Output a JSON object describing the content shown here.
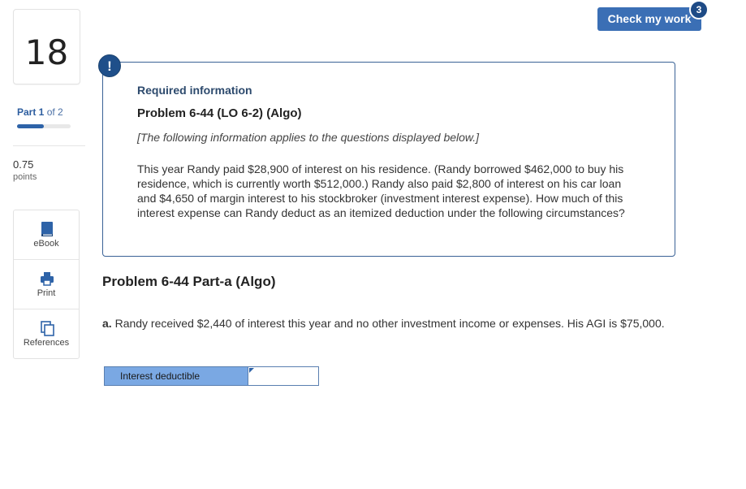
{
  "question": {
    "number": "18"
  },
  "part": {
    "current": "Part 1",
    "of": "of 2",
    "progress": 0.5
  },
  "points": {
    "value": "0.75",
    "label": "points"
  },
  "tools": [
    {
      "label": "eBook",
      "icon": "book-icon"
    },
    {
      "label": "Print",
      "icon": "printer-icon"
    },
    {
      "label": "References",
      "icon": "references-icon"
    }
  ],
  "check_work": {
    "label": "Check my work",
    "badge": "3"
  },
  "required_info": {
    "alert": "!",
    "heading": "Required information",
    "title": "Problem 6-44 (LO 6-2) (Algo)",
    "note": "[The following information applies to the questions displayed below.]",
    "body": "This year Randy paid $28,900 of interest on his residence. (Randy borrowed $462,000 to buy his residence, which is currently worth $512,000.) Randy also paid $2,800 of interest on his car loan and $4,650 of margin interest to his stockbroker (investment interest expense). How much of this interest expense can Randy deduct as an itemized deduction under the following circumstances?"
  },
  "part_a": {
    "title": "Problem 6-44 Part-a (Algo)",
    "prefix": "a.",
    "question": "Randy received $2,440 of interest this year and no other investment income or expenses. His AGI is $75,000.",
    "answer_label": "Interest deductible",
    "answer_value": ""
  },
  "colors": {
    "accent": "#3b6fb5",
    "dark_accent": "#1f4f8a",
    "answer_label_bg": "#7aa8e3"
  }
}
